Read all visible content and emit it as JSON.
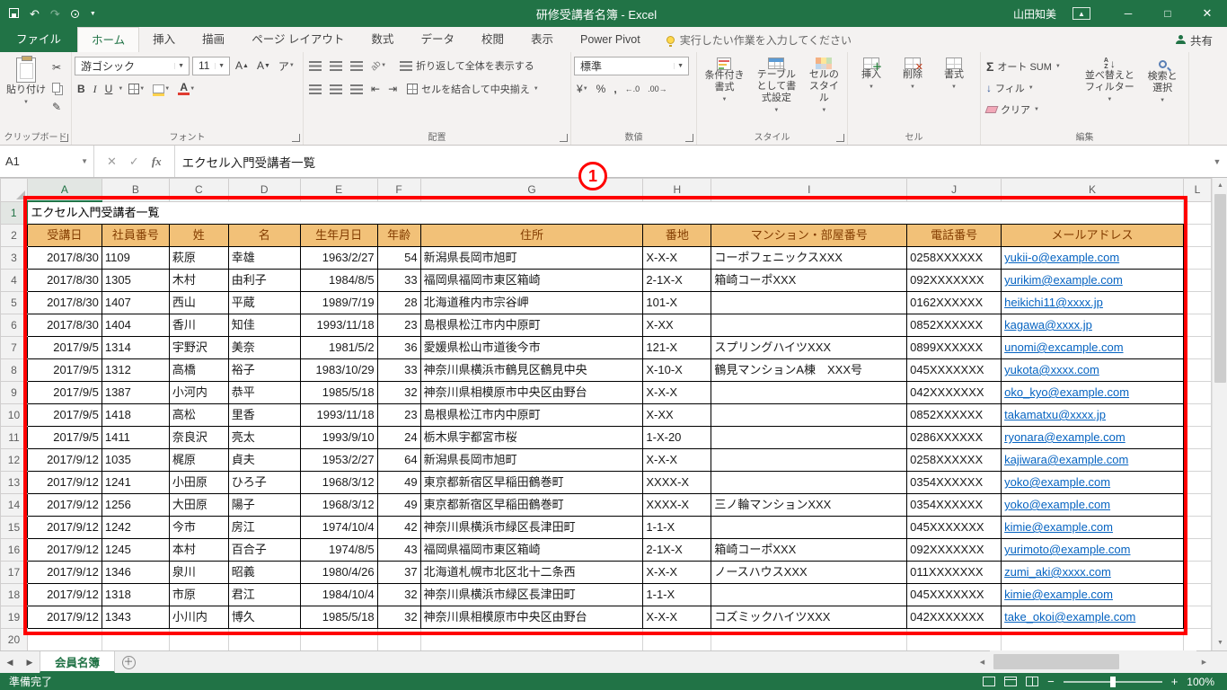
{
  "colors": {
    "accent_green": "#217346",
    "annotation_red": "#ff0000",
    "table_header_fill": "#f2c178",
    "link_blue": "#0563c1"
  },
  "title_bar": {
    "title": "研修受講者名簿 - Excel",
    "user": "山田知美",
    "quick_access_icons": [
      "save-icon",
      "undo-icon",
      "redo-icon",
      "touch-mode-icon",
      "customize-qat-caret"
    ]
  },
  "tab_bar": {
    "file": "ファイル",
    "tabs": [
      "ホーム",
      "挿入",
      "描画",
      "ページ レイアウト",
      "数式",
      "データ",
      "校閲",
      "表示",
      "Power Pivot"
    ],
    "tell_me": "実行したい作業を入力してください",
    "share": "共有"
  },
  "ribbon": {
    "groups": [
      "クリップボード",
      "フォント",
      "配置",
      "数値",
      "スタイル",
      "セル",
      "編集"
    ],
    "paste": "貼り付け",
    "font_name": "游ゴシック",
    "font_size": "11",
    "wrap_text": "折り返して全体を表示する",
    "merge_center": "セルを結合して中央揃え",
    "number_format": "標準",
    "conditional": "条件付き書式",
    "format_table": "テーブルとして書式設定",
    "cell_styles": "セルのスタイル",
    "insert": "挿入",
    "delete": "削除",
    "format": "書式",
    "autosum": "オート SUM",
    "fill": "フィル",
    "clear": "クリア",
    "sort_filter": "並べ替えとフィルター",
    "find_select": "検索と選択"
  },
  "formula_bar": {
    "name_box": "A1",
    "value": "エクセル入門受講者一覧"
  },
  "annotation": {
    "badge_label": "1"
  },
  "grid": {
    "columns": [
      "A",
      "B",
      "C",
      "D",
      "E",
      "F",
      "G",
      "H",
      "I",
      "J",
      "K",
      "L"
    ],
    "row_numbers": [
      "1",
      "2",
      "3",
      "4",
      "5",
      "6",
      "7",
      "8",
      "9",
      "10",
      "11",
      "12",
      "13",
      "14",
      "15",
      "16",
      "17",
      "18",
      "19",
      "20"
    ],
    "title_cell": "エクセル入門受講者一覧",
    "headers": [
      "受講日",
      "社員番号",
      "姓",
      "名",
      "生年月日",
      "年齢",
      "住所",
      "番地",
      "マンション・部屋番号",
      "電話番号",
      "メールアドレス"
    ],
    "rows": [
      [
        "2017/8/30",
        "1109",
        "萩原",
        "幸雄",
        "1963/2/27",
        "54",
        "新潟県長岡市旭町",
        "X-X-X",
        "コーポフェニックスXXX",
        "0258XXXXXX",
        "yukii-o@example.com"
      ],
      [
        "2017/8/30",
        "1305",
        "木村",
        "由利子",
        "1984/8/5",
        "33",
        "福岡県福岡市東区箱崎",
        "2-1X-X",
        "箱崎コーポXXX",
        "092XXXXXXX",
        "yurikim@example.com"
      ],
      [
        "2017/8/30",
        "1407",
        "西山",
        "平蔵",
        "1989/7/19",
        "28",
        "北海道稚内市宗谷岬",
        "101-X",
        "",
        "0162XXXXXX",
        "heikichi11@xxxx.jp"
      ],
      [
        "2017/8/30",
        "1404",
        "香川",
        "知佳",
        "1993/11/18",
        "23",
        "島根県松江市内中原町",
        "X-XX",
        "",
        "0852XXXXXX",
        "kagawa@xxxx.jp"
      ],
      [
        "2017/9/5",
        "1314",
        "宇野沢",
        "美奈",
        "1981/5/2",
        "36",
        "愛媛県松山市道後今市",
        "121-X",
        "スプリングハイツXXX",
        "0899XXXXXX",
        "unomi@excample.com"
      ],
      [
        "2017/9/5",
        "1312",
        "高橋",
        "裕子",
        "1983/10/29",
        "33",
        "神奈川県横浜市鶴見区鶴見中央",
        "X-10-X",
        "鶴見マンションA棟　XXX号",
        "045XXXXXXX",
        "yukota@xxxx.com"
      ],
      [
        "2017/9/5",
        "1387",
        "小河内",
        "恭平",
        "1985/5/18",
        "32",
        "神奈川県相模原市中央区由野台",
        "X-X-X",
        "",
        "042XXXXXXX",
        "oko_kyo@example.com"
      ],
      [
        "2017/9/5",
        "1418",
        "高松",
        "里香",
        "1993/11/18",
        "23",
        "島根県松江市内中原町",
        "X-XX",
        "",
        "0852XXXXXX",
        "takamatxu@xxxx.jp"
      ],
      [
        "2017/9/5",
        "1411",
        "奈良沢",
        "亮太",
        "1993/9/10",
        "24",
        "栃木県宇都宮市桜",
        "1-X-20",
        "",
        "0286XXXXXX",
        "ryonara@example.com"
      ],
      [
        "2017/9/12",
        "1035",
        "梶原",
        "貞夫",
        "1953/2/27",
        "64",
        "新潟県長岡市旭町",
        "X-X-X",
        "",
        "0258XXXXXX",
        "kajiwara@example.com"
      ],
      [
        "2017/9/12",
        "1241",
        "小田原",
        "ひろ子",
        "1968/3/12",
        "49",
        "東京都新宿区早稲田鶴巻町",
        "XXXX-X",
        "",
        "0354XXXXXX",
        "yoko@example.com"
      ],
      [
        "2017/9/12",
        "1256",
        "大田原",
        "陽子",
        "1968/3/12",
        "49",
        "東京都新宿区早稲田鶴巻町",
        "XXXX-X",
        "三ノ輪マンションXXX",
        "0354XXXXXX",
        "yoko@example.com"
      ],
      [
        "2017/9/12",
        "1242",
        "今市",
        "房江",
        "1974/10/4",
        "42",
        "神奈川県横浜市緑区長津田町",
        "1-1-X",
        "",
        "045XXXXXXX",
        "kimie@example.com"
      ],
      [
        "2017/9/12",
        "1245",
        "本村",
        "百合子",
        "1974/8/5",
        "43",
        "福岡県福岡市東区箱崎",
        "2-1X-X",
        "箱崎コーポXXX",
        "092XXXXXXX",
        "yurimoto@example.com"
      ],
      [
        "2017/9/12",
        "1346",
        "泉川",
        "昭義",
        "1980/4/26",
        "37",
        "北海道札幌市北区北十二条西",
        "X-X-X",
        "ノースハウスXXX",
        "011XXXXXXX",
        "zumi_aki@xxxx.com"
      ],
      [
        "2017/9/12",
        "1318",
        "市原",
        "君江",
        "1984/10/4",
        "32",
        "神奈川県横浜市緑区長津田町",
        "1-1-X",
        "",
        "045XXXXXXX",
        "kimie@example.com"
      ],
      [
        "2017/9/12",
        "1343",
        "小川内",
        "博久",
        "1985/5/18",
        "32",
        "神奈川県相模原市中央区由野台",
        "X-X-X",
        "コズミックハイツXXX",
        "042XXXXXXX",
        "take_okoi@example.com"
      ]
    ]
  },
  "sheet_tabs": {
    "active": "会員名簿"
  },
  "status_bar": {
    "mode": "準備完了",
    "zoom": "100%"
  }
}
